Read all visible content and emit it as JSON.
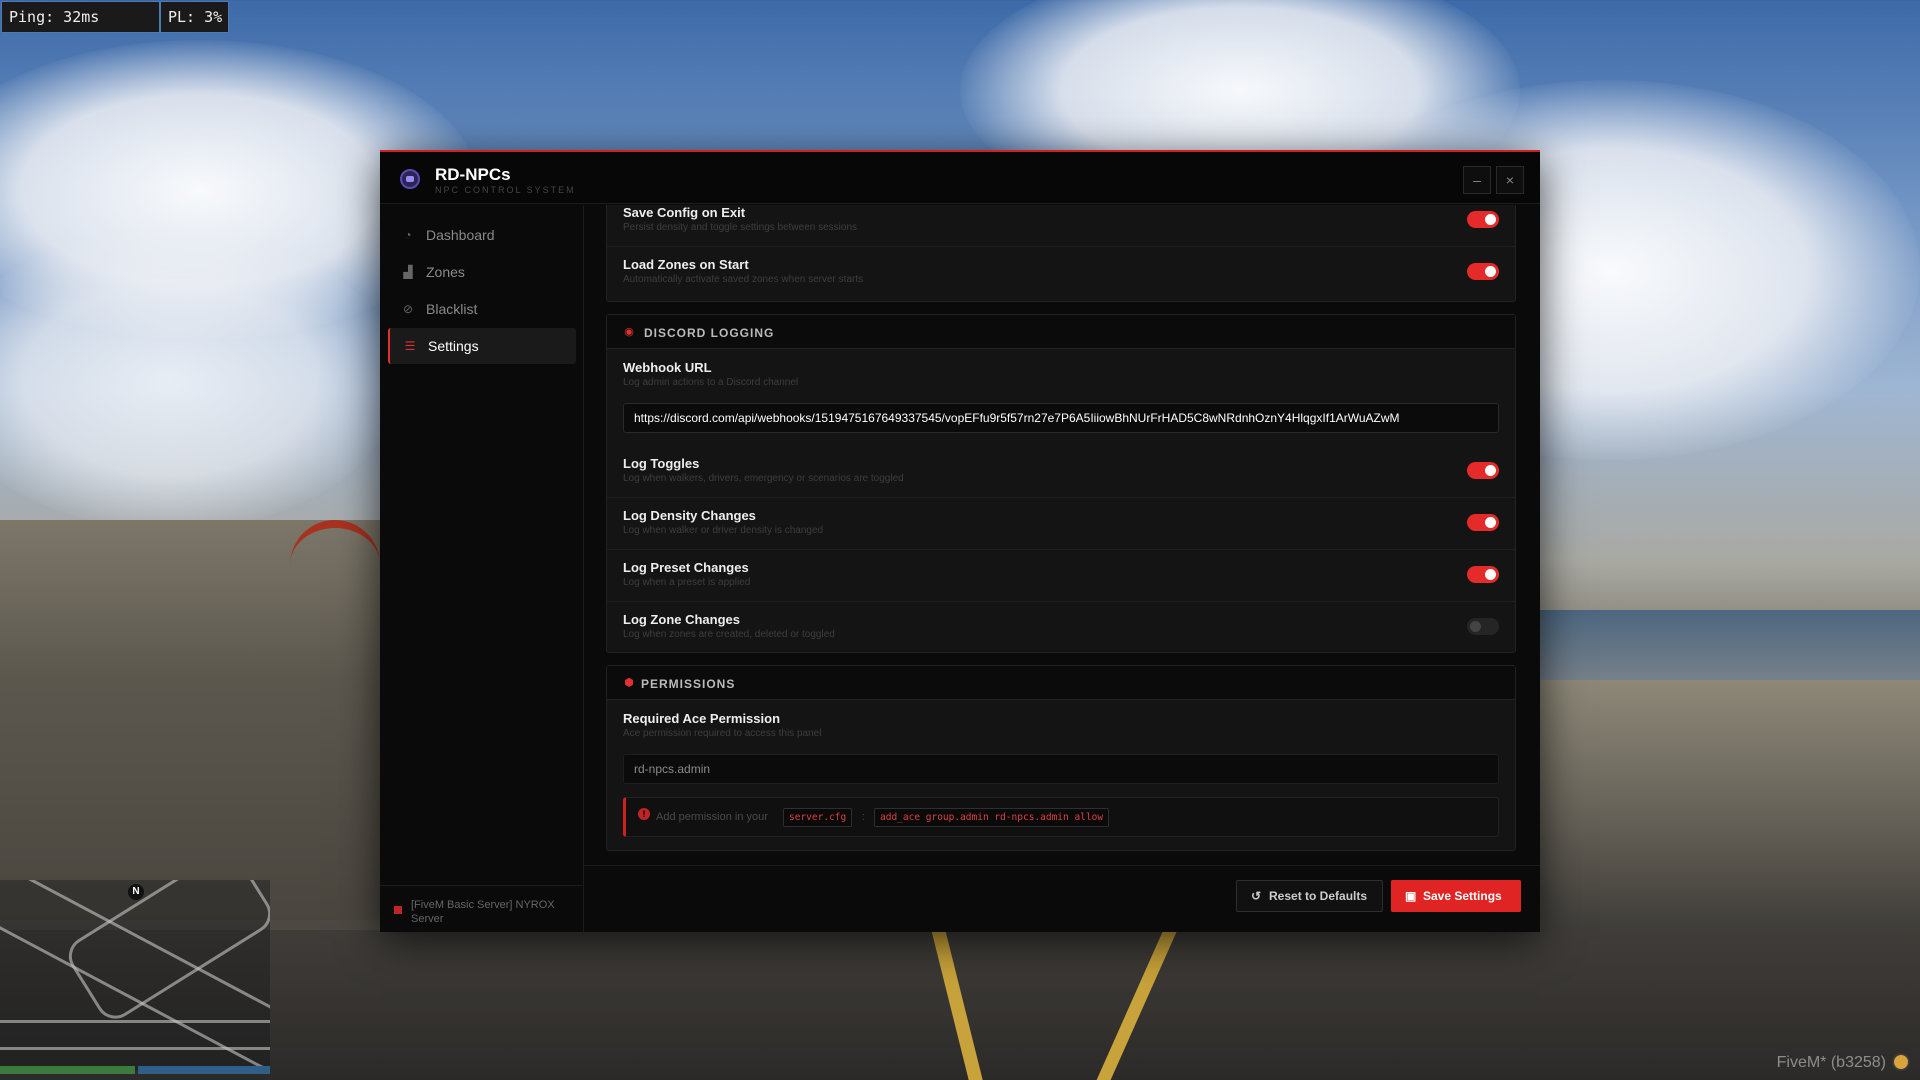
{
  "hud": {
    "ping": "Ping: 32ms",
    "packet_loss": "PL: 3%",
    "watermark": "FiveM* (b3258)",
    "compass": "N"
  },
  "app": {
    "title": "RD-NPCs",
    "subtitle": "NPC CONTROL SYSTEM",
    "minimize": "–",
    "close": "×"
  },
  "sidebar": {
    "items": [
      {
        "label": "Dashboard",
        "icon": "dashboard-icon",
        "glyph": "◔"
      },
      {
        "label": "Zones",
        "icon": "zones-icon",
        "glyph": "▟"
      },
      {
        "label": "Blacklist",
        "icon": "blacklist-icon",
        "glyph": "⊘"
      },
      {
        "label": "Settings",
        "icon": "settings-sliders-icon",
        "glyph": "☰"
      }
    ],
    "active": "Settings",
    "server": "[FiveM Basic Server] NYROX Server"
  },
  "general": {
    "rows": [
      {
        "title": "Save Config on Exit",
        "desc": "Persist density and toggle settings between sessions",
        "enabled": true
      },
      {
        "title": "Load Zones on Start",
        "desc": "Automatically activate saved zones when server starts",
        "enabled": true
      }
    ]
  },
  "discord": {
    "header": "DISCORD LOGGING",
    "webhook": {
      "title": "Webhook URL",
      "desc": "Log admin actions to a Discord channel",
      "value": "https://discord.com/api/webhooks/1519475167649337545/vopEFfu9r5f57rn27e7P6A5IiiowBhNUrFrHAD5C8wNRdnhOznY4HlqgxIf1ArWuAZwM"
    },
    "rows": [
      {
        "title": "Log Toggles",
        "desc": "Log when walkers, drivers, emergency or scenarios are toggled",
        "enabled": true
      },
      {
        "title": "Log Density Changes",
        "desc": "Log when walker or driver density is changed",
        "enabled": true
      },
      {
        "title": "Log Preset Changes",
        "desc": "Log when a preset is applied",
        "enabled": true
      },
      {
        "title": "Log Zone Changes",
        "desc": "Log when zones are created, deleted or toggled",
        "enabled": false
      }
    ]
  },
  "permissions": {
    "header": "PERMISSIONS",
    "title": "Required Ace Permission",
    "desc": "Ace permission required to access this panel",
    "value": "rd-npcs.admin",
    "notice_text": "Add permission in your",
    "notice_file": "server.cfg",
    "notice_sep": ":",
    "notice_cmd": "add_ace group.admin rd-npcs.admin allow"
  },
  "footer": {
    "reset": "Reset to Defaults",
    "save": "Save Settings"
  },
  "colors": {
    "accent": "#e02424",
    "toggle_off": "#252525"
  }
}
